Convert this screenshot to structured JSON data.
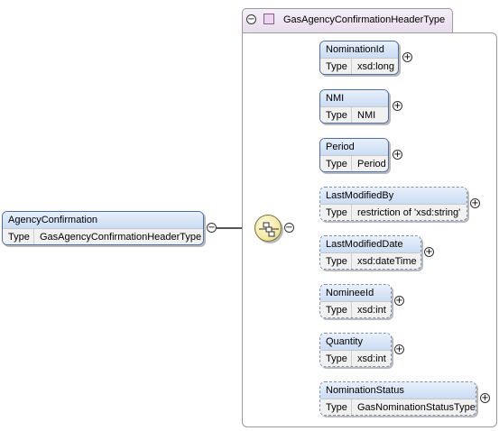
{
  "diagram": {
    "root": {
      "name": "AgencyConfirmation",
      "type_label": "Type",
      "type_value": "GasAgencyConfirmationHeaderType",
      "toggle": "−"
    },
    "complex_type": {
      "name": "GasAgencyConfirmationHeaderType",
      "toggle": "−"
    },
    "sequence_toggle": "−",
    "children": [
      {
        "name": "NominationId",
        "type_label": "Type",
        "type_value": "xsd:long",
        "toggle": "+",
        "required": true
      },
      {
        "name": "NMI",
        "type_label": "Type",
        "type_value": "NMI",
        "toggle": "+",
        "required": true
      },
      {
        "name": "Period",
        "type_label": "Type",
        "type_value": "Period",
        "toggle": "+",
        "required": true
      },
      {
        "name": "LastModifiedBy",
        "type_label": "Type",
        "type_value": "restriction of 'xsd:string'",
        "toggle": "+",
        "required": false
      },
      {
        "name": "LastModifiedDate",
        "type_label": "Type",
        "type_value": "xsd:dateTime",
        "toggle": "+",
        "required": false
      },
      {
        "name": "NomineeId",
        "type_label": "Type",
        "type_value": "xsd:int",
        "toggle": "+",
        "required": false
      },
      {
        "name": "Quantity",
        "type_label": "Type",
        "type_value": "xsd:int",
        "toggle": "+",
        "required": false
      },
      {
        "name": "NominationStatus",
        "type_label": "Type",
        "type_value": "GasNominationStatusType",
        "toggle": "+",
        "required": false
      }
    ],
    "colors": {
      "element_header": "#cbdcf3",
      "element_border": "#4f6fa8",
      "compositor_fill": "#f3e9a4",
      "connector": "#555555"
    }
  }
}
